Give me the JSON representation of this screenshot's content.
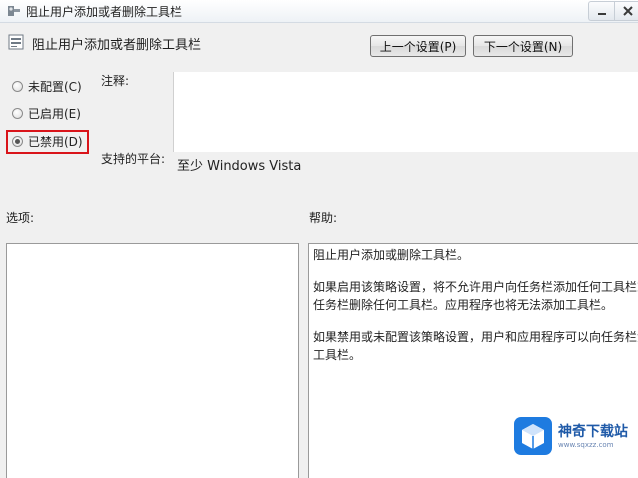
{
  "window": {
    "title": "阻止用户添加或者删除工具栏"
  },
  "header": {
    "title": "阻止用户添加或者删除工具栏",
    "prev_button": "上一个设置(P)",
    "next_button": "下一个设置(N)"
  },
  "state": {
    "options": [
      {
        "label": "未配置(C)",
        "checked": false
      },
      {
        "label": "已启用(E)",
        "checked": false
      },
      {
        "label": "已禁用(D)",
        "checked": true
      }
    ],
    "highlight_color": "#d9141a"
  },
  "fields": {
    "comment_label": "注释:",
    "comment_value": "",
    "platform_label": "支持的平台:",
    "platform_value": "至少 Windows Vista"
  },
  "panels": {
    "options_label": "选项:",
    "help_label": "帮助:",
    "help_lines": [
      "阻止用户添加或删除工具栏。",
      "如果启用该策略设置，将不允许用户向任务栏添加任何工具栏或",
      "任务栏删除任何工具栏。应用程序也将无法添加工具栏。",
      "如果禁用或未配置该策略设置，用户和应用程序可以向任务栏添",
      "工具栏。"
    ]
  },
  "watermark": {
    "text": "神奇下载站",
    "sub": "www.sqxzz.com"
  }
}
